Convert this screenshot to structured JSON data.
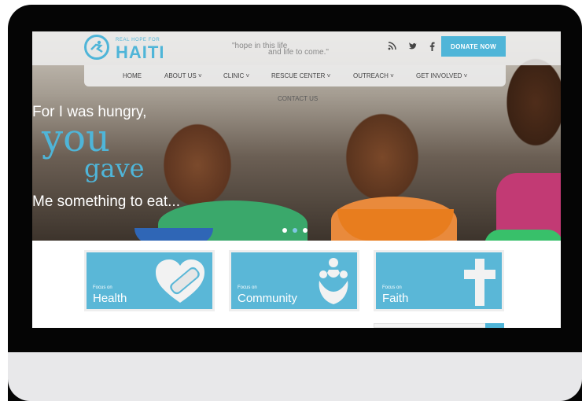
{
  "header": {
    "logo_small": "REAL HOPE FOR",
    "logo_big": "HAITI",
    "tagline_1": "\"hope in this life",
    "tagline_2": "and life to come.\"",
    "donate_label": "DONATE NOW",
    "social": [
      "rss-icon",
      "twitter-icon",
      "facebook-icon"
    ]
  },
  "nav": {
    "items": [
      "HOME",
      "ABOUT US ˅",
      "CLINIC ˅",
      "RESCUE CENTER ˅",
      "OUTREACH ˅",
      "GET INVOLVED ˅"
    ],
    "second_row": "CONTACT US"
  },
  "hero": {
    "line1": "For I was hungry,",
    "line2": "you",
    "line3": "gave",
    "line4": "Me something to eat...",
    "dots": 3,
    "active_dot": 1
  },
  "cards": [
    {
      "focus": "Focus on",
      "title": "Health",
      "icon": "heart-bandage-icon"
    },
    {
      "focus": "Focus on",
      "title": "Community",
      "icon": "family-icon"
    },
    {
      "focus": "Focus on",
      "title": "Faith",
      "icon": "cross-icon"
    }
  ],
  "colors": {
    "accent": "#4fb5d8",
    "card": "#5ab7d7",
    "frame": "#050505",
    "chin": "#e8e8ea"
  }
}
